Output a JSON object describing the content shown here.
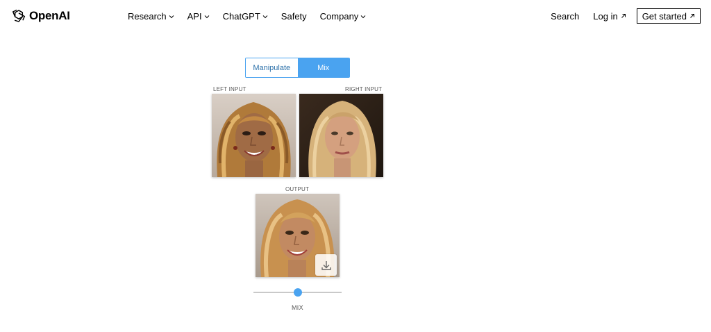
{
  "header": {
    "logo_text": "OpenAI",
    "nav": [
      {
        "label": "Research",
        "has_dropdown": true
      },
      {
        "label": "API",
        "has_dropdown": true
      },
      {
        "label": "ChatGPT",
        "has_dropdown": true
      },
      {
        "label": "Safety",
        "has_dropdown": false
      },
      {
        "label": "Company",
        "has_dropdown": true
      }
    ],
    "search_label": "Search",
    "login_label": "Log in",
    "get_started_label": "Get started"
  },
  "tabs": {
    "manipulate_label": "Manipulate",
    "mix_label": "Mix",
    "active": "Mix"
  },
  "inputs": {
    "left_label": "LEFT INPUT",
    "right_label": "RIGHT INPUT",
    "output_label": "OUTPUT"
  },
  "slider": {
    "label": "MIX",
    "value": 0.5
  },
  "colors": {
    "accent": "#4aa3f0",
    "text": "#000000",
    "muted": "#555555"
  },
  "icons": {
    "logo": "openai-logo-icon",
    "dropdown": "chevron-down-icon",
    "external": "arrow-up-right-icon",
    "download": "download-icon"
  }
}
